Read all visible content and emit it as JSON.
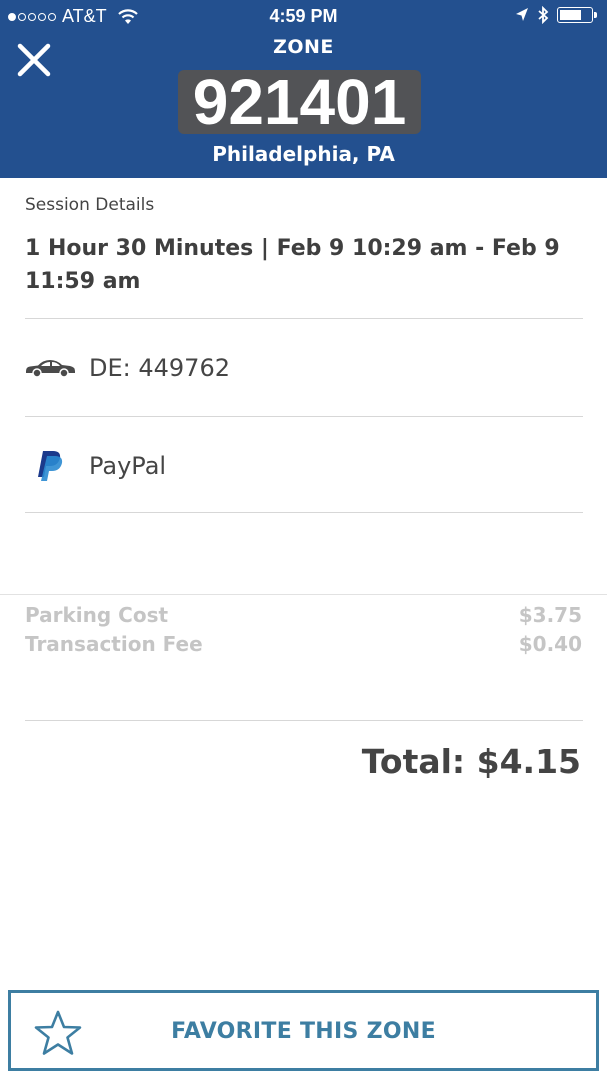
{
  "status_bar": {
    "carrier": "AT&T",
    "time": "4:59 PM",
    "signal_bars_filled": 1,
    "signal_bars_total": 5,
    "battery_level_fraction": 0.62
  },
  "header": {
    "zone_label": "ZONE",
    "zone_number": "921401",
    "city": "Philadelphia, PA",
    "close_icon": "close-icon",
    "background_color": "#23508f"
  },
  "session": {
    "label": "Session Details",
    "time_range": "1 Hour 30 Minutes | Feb 9 10:29 am - Feb 9 11:59 am"
  },
  "vehicle": {
    "icon": "car-icon",
    "plate": "DE: 449762"
  },
  "payment": {
    "icon": "paypal-icon",
    "method": "PayPal"
  },
  "fees": [
    {
      "label": "Parking Cost",
      "amount": "$3.75"
    },
    {
      "label": "Transaction Fee",
      "amount": "$0.40"
    }
  ],
  "total": "Total: $4.15",
  "favorite_button": {
    "icon": "star-icon",
    "label": "FAVORITE THIS ZONE",
    "color": "#3d7ea2"
  }
}
